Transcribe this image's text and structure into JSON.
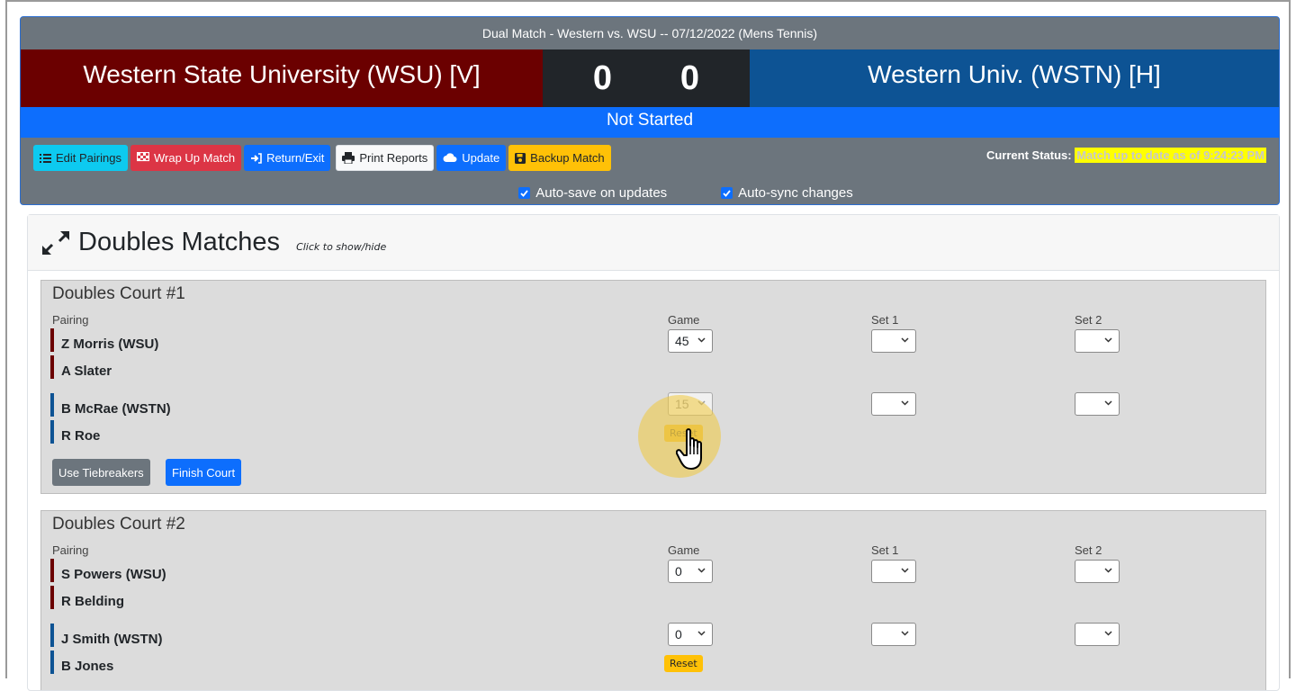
{
  "header": {
    "title": "Dual Match - Western vs. WSU -- 07/12/2022 (Mens Tennis)",
    "visitor_team": "Western State University (WSU) [V]",
    "home_team": "Western Univ. (WSTN) [H]",
    "visitor_score": "0",
    "home_score": "0",
    "match_status": "Not Started"
  },
  "toolbar": {
    "edit_pairings": "Edit Pairings",
    "wrap_up": "Wrap Up Match",
    "return_exit": "Return/Exit",
    "print_reports": "Print Reports",
    "update": "Update",
    "backup": "Backup Match"
  },
  "current_status": {
    "label": "Current Status:",
    "value": "Match up to date as of 9:24:23 PM"
  },
  "options": {
    "auto_save": "Auto-save on updates",
    "auto_sync": "Auto-sync changes"
  },
  "section": {
    "title": "Doubles Matches",
    "hint": "Click to show/hide"
  },
  "labels": {
    "pairing": "Pairing",
    "game": "Game",
    "set1": "Set 1",
    "set2": "Set 2",
    "reset": "Reset",
    "use_tiebreakers": "Use Tiebreakers",
    "finish_court": "Finish Court"
  },
  "courts": [
    {
      "title": "Doubles Court #1",
      "visitor_p1": "Z Morris (WSU)",
      "visitor_p2": "A Slater",
      "home_p1": "B McRae (WSTN)",
      "home_p2": "R Roe",
      "visitor_game": "45",
      "home_game": "15"
    },
    {
      "title": "Doubles Court #2",
      "visitor_p1": "S Powers (WSU)",
      "visitor_p2": "R Belding",
      "home_p1": "J Smith (WSTN)",
      "home_p2": "B Jones",
      "visitor_game": "0",
      "home_game": "0"
    }
  ],
  "colors": {
    "visitor": "#6b0000",
    "home": "#0d5394",
    "status_bar": "#0d6efd",
    "header_bg": "#6c757d",
    "highlight": "#ffff00"
  }
}
